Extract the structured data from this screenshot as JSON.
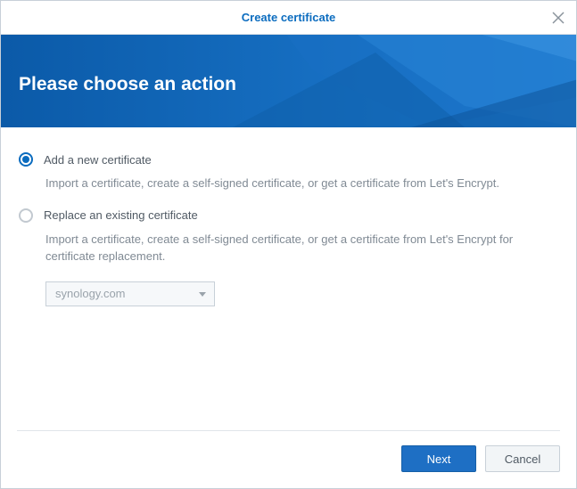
{
  "dialog": {
    "title": "Create certificate"
  },
  "banner": {
    "heading": "Please choose an action"
  },
  "options": [
    {
      "label": "Add a new certificate",
      "description": "Import a certificate, create a self-signed certificate, or get a certificate from Let's Encrypt.",
      "selected": true
    },
    {
      "label": "Replace an existing certificate",
      "description": "Import a certificate, create a self-signed certificate, or get a certificate from Let's Encrypt for certificate replacement.",
      "selected": false
    }
  ],
  "replace_select": {
    "value": "synology.com"
  },
  "buttons": {
    "next": "Next",
    "cancel": "Cancel"
  }
}
